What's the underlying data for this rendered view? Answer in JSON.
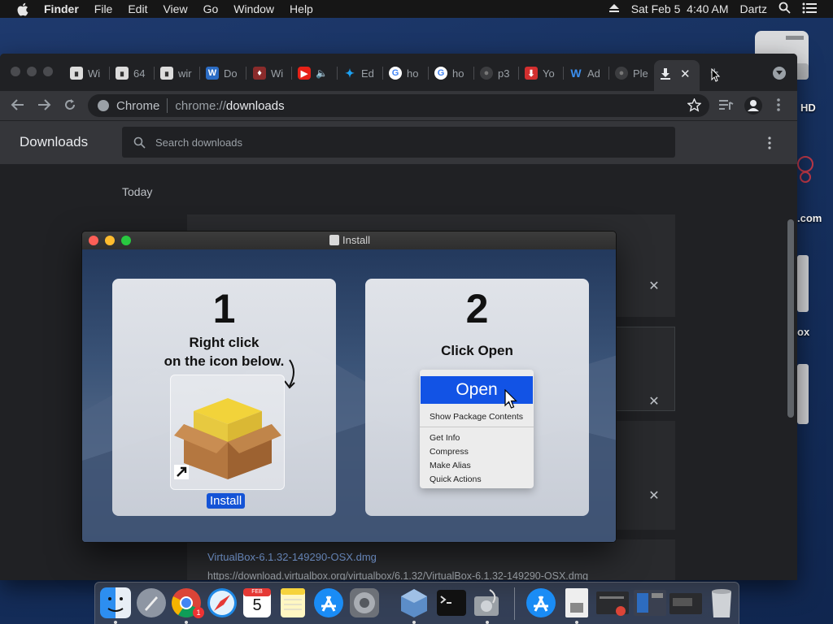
{
  "menubar": {
    "app": "Finder",
    "menus": [
      "File",
      "Edit",
      "View",
      "Go",
      "Window",
      "Help"
    ],
    "datetime": "Sat Feb 5  4:40 AM",
    "user": "Dartz"
  },
  "desktop": {
    "label_hd": "HD",
    "label_com": ".com",
    "label_ox": "ox"
  },
  "browser": {
    "tabs": [
      {
        "title": "Wi",
        "icon": "museum-icon"
      },
      {
        "title": "64",
        "icon": "museum-icon"
      },
      {
        "title": "wir",
        "icon": "museum-icon"
      },
      {
        "title": "Do",
        "icon": "doc-icon"
      },
      {
        "title": "Wi",
        "icon": "shield-icon"
      },
      {
        "title": "",
        "icon": "youtube-icon"
      },
      {
        "title": "Ed",
        "icon": "twitter-icon"
      },
      {
        "title": "ho",
        "icon": "google-icon"
      },
      {
        "title": "ho",
        "icon": "google-icon"
      },
      {
        "title": "p3",
        "icon": "globe-icon"
      },
      {
        "title": "Yo",
        "icon": "download-arrow-icon"
      },
      {
        "title": "Ad",
        "icon": "w-icon"
      },
      {
        "title": "Ple",
        "icon": "globe-icon"
      }
    ],
    "site_label": "Chrome",
    "url_prefix": "chrome://",
    "url_path": "downloads"
  },
  "downloads": {
    "title": "Downloads",
    "search_placeholder": "Search downloads",
    "section": "Today",
    "last_item_name": "VirtualBox-6.1.32-149290-OSX.dmg",
    "last_item_url": "https://download.virtualbox.org/virtualbox/6.1.32/VirtualBox-6.1.32-149290-OSX.dmg"
  },
  "installer": {
    "window_title": "Install",
    "step1": {
      "number": "1",
      "line1": "Right click",
      "line2": "on the icon below.",
      "icon_label": "Install"
    },
    "step2": {
      "number": "2",
      "text": "Click Open"
    },
    "context_menu": {
      "open": "Open",
      "items": [
        "Show Package Contents",
        "Get Info",
        "Compress",
        "Make Alias",
        "Quick Actions"
      ]
    }
  },
  "dock": {
    "calendar_day": "5",
    "calendar_month": "FEB",
    "badge": "1"
  },
  "colors": {
    "menubar_bg": "#161616",
    "chrome_bg": "#202124",
    "chrome_toolbar": "#35363a",
    "link_blue": "#8ab4f8",
    "selection_blue": "#1253e5"
  }
}
